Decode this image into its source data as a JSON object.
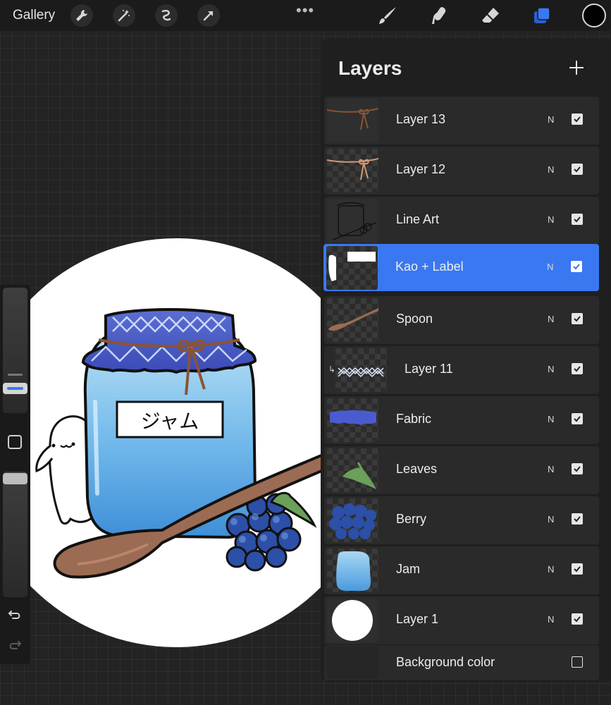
{
  "toolbar": {
    "gallery_label": "Gallery",
    "left_tools": [
      "wrench-icon",
      "magic-wand-icon",
      "selection-icon",
      "transform-icon"
    ],
    "more_icon": "ellipsis-icon",
    "right_tools": [
      "brush-icon",
      "smudge-icon",
      "eraser-icon",
      "layers-icon"
    ],
    "active_tool": "layers-icon",
    "current_color": "#000000"
  },
  "sidebar": {
    "brush_size_level": 0.62,
    "opacity_level": 1.0,
    "modify_button_icon": "square-icon",
    "undo_icon": "undo-icon",
    "redo_icon": "redo-icon"
  },
  "artwork": {
    "label_text": "ジャム"
  },
  "layers_panel": {
    "title": "Layers",
    "add_icon": "plus-icon",
    "accent_color": "#3a78f2",
    "layers": [
      {
        "name": "Layer 13",
        "blend": "N",
        "visible": true
      },
      {
        "name": "Layer 12",
        "blend": "N",
        "visible": true
      },
      {
        "name": "Line Art",
        "blend": "N",
        "visible": true
      },
      {
        "name": "Kao + Label",
        "blend": "N",
        "visible": true,
        "selected": true
      },
      {
        "name": "Spoon",
        "blend": "N",
        "visible": true
      },
      {
        "name": "Layer 11",
        "blend": "N",
        "visible": true,
        "clipping_mask": true
      },
      {
        "name": "Fabric",
        "blend": "N",
        "visible": true
      },
      {
        "name": "Leaves",
        "blend": "N",
        "visible": true
      },
      {
        "name": "Berry",
        "blend": "N",
        "visible": true
      },
      {
        "name": "Jam",
        "blend": "N",
        "visible": true
      },
      {
        "name": "Layer 1",
        "blend": "N",
        "visible": true
      },
      {
        "name": "Background color",
        "visible": false
      }
    ]
  }
}
